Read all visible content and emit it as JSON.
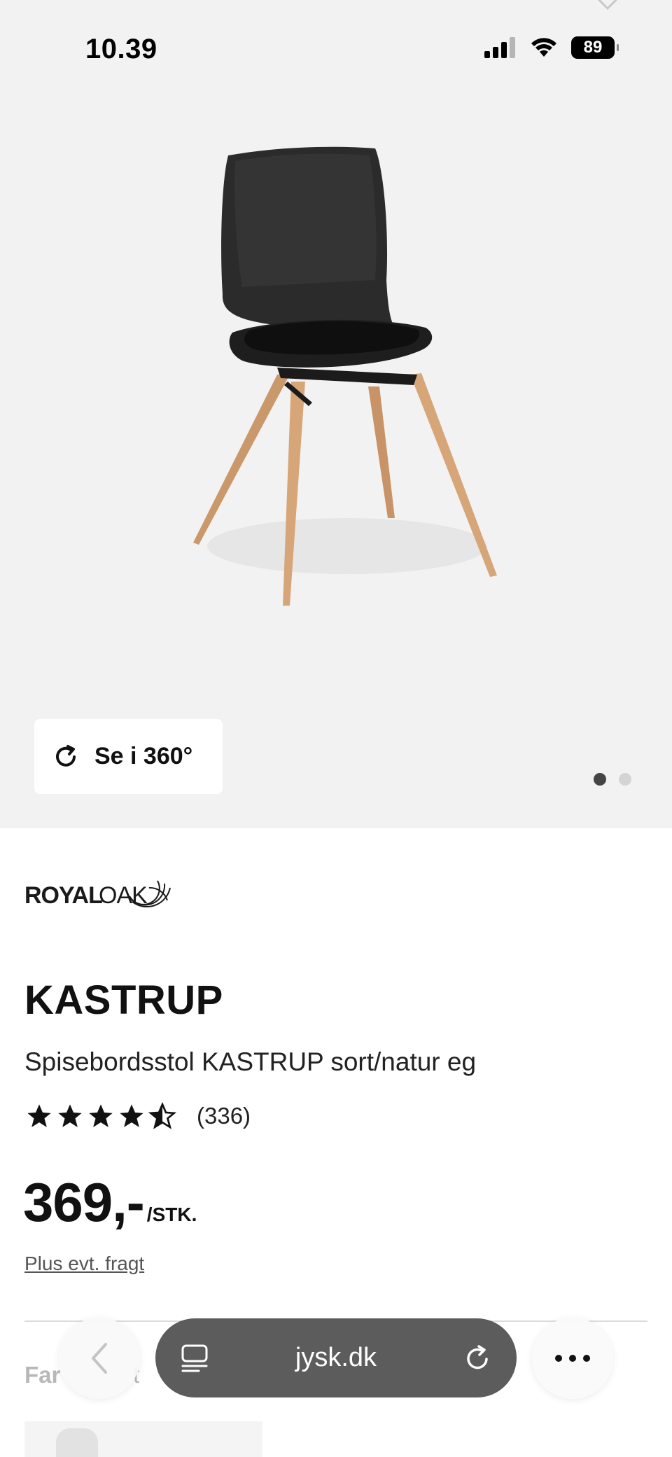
{
  "status_bar": {
    "time": "10.39",
    "battery": "89"
  },
  "gallery": {
    "view_360_label": "Se i 360°",
    "dot_count": 2,
    "active_dot": 1
  },
  "product": {
    "brand": "ROYALOAK",
    "title": "KASTRUP",
    "description": "Spisebordsstol KASTRUP sort/natur eg",
    "rating": 4.5,
    "rating_count": "(336)",
    "price": "369,-",
    "price_unit": "/STK.",
    "shipping_link": "Plus evt. fragt"
  },
  "next_section": {
    "label_partial_1": "Far",
    "label_partial_2": "t"
  },
  "browser": {
    "url": "jysk.dk"
  },
  "colors": {
    "hero_bg": "#f2f2f2",
    "url_bar_bg": "#5c5c5c",
    "text_primary": "#111111"
  }
}
